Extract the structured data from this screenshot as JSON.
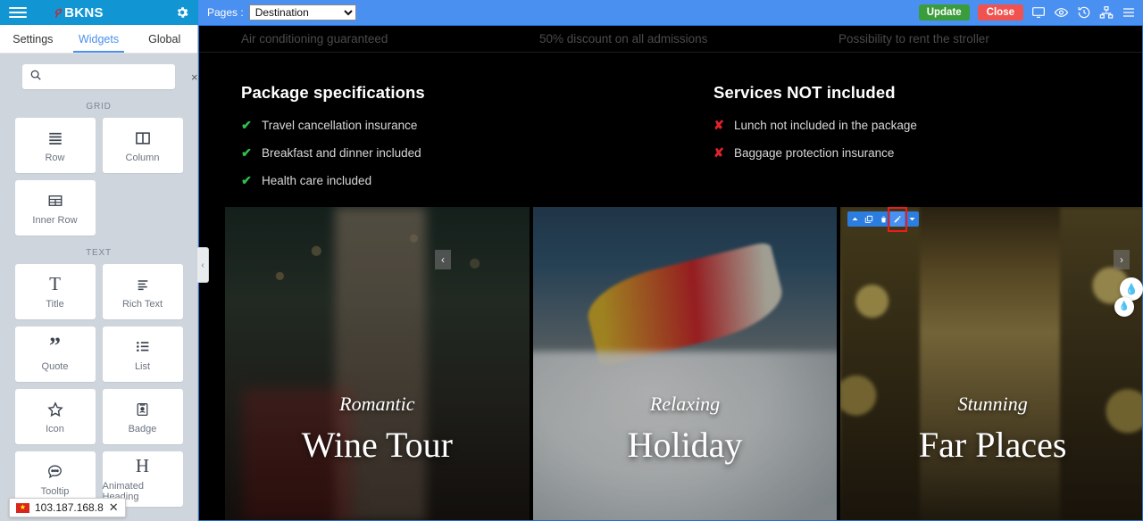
{
  "topbar": {
    "menu_icon": "hamburger-icon",
    "brand_mark": "logo-mark",
    "brand": "BKNS",
    "gear_icon": "gear-icon",
    "pages_label": "Pages :",
    "page_selected": "Destination",
    "page_options": [
      "Destination"
    ],
    "update_label": "Update",
    "close_label": "Close",
    "icons": [
      "desktop-icon",
      "eye-icon",
      "history-icon",
      "sitemap-icon",
      "menu-icon"
    ]
  },
  "panel": {
    "tabs": [
      {
        "label": "Settings",
        "active": false
      },
      {
        "label": "Widgets",
        "active": true
      },
      {
        "label": "Global",
        "active": false
      }
    ],
    "search": {
      "value": "",
      "placeholder": "",
      "icon": "search-icon",
      "clear": "×"
    },
    "groups": [
      {
        "title": "GRID",
        "items": [
          {
            "label": "Row",
            "icon": "rows-icon"
          },
          {
            "label": "Column",
            "icon": "columns-icon"
          },
          {
            "label": "Inner Row",
            "icon": "table-icon"
          }
        ]
      },
      {
        "title": "TEXT",
        "items": [
          {
            "label": "Title",
            "icon": "title-icon"
          },
          {
            "label": "Rich Text",
            "icon": "align-left-icon"
          },
          {
            "label": "Quote",
            "icon": "quote-icon"
          },
          {
            "label": "List",
            "icon": "list-icon"
          },
          {
            "label": "Icon",
            "icon": "star-icon"
          },
          {
            "label": "Badge",
            "icon": "badge-icon"
          },
          {
            "label": "Tooltip",
            "icon": "tooltip-icon"
          },
          {
            "label": "Animated Heading",
            "icon": "heading-icon"
          }
        ]
      }
    ],
    "ip_badge": {
      "flag": "vn-flag-icon",
      "ip": "103.187.168.8",
      "close": "✕"
    }
  },
  "canvas": {
    "top_strip": [
      "Air conditioning guaranteed",
      "50% discount on all admissions",
      "Possibility to rent the stroller"
    ],
    "specs": {
      "included": {
        "heading": "Package specifications",
        "items": [
          "Travel cancellation insurance",
          "Breakfast and dinner included",
          "Health care included"
        ],
        "mark": "✔"
      },
      "excluded": {
        "heading": "Services NOT included",
        "items": [
          "Lunch not included in the package",
          "Baggage protection insurance"
        ],
        "mark": "✘"
      }
    },
    "element_toolbar": {
      "buttons": [
        {
          "name": "move-up-icon",
          "glyph": "▲",
          "selected": false
        },
        {
          "name": "duplicate-icon",
          "glyph": "⧉",
          "selected": false
        },
        {
          "name": "delete-icon",
          "glyph": "Ὕ1",
          "selected": false
        },
        {
          "name": "edit-pencil-icon",
          "glyph": "✎",
          "selected": true
        },
        {
          "name": "more-options-icon",
          "glyph": "▼",
          "selected": false
        }
      ],
      "highlight_color": "#ee1b1b"
    },
    "carousel": {
      "prev": "‹",
      "next": "›",
      "slides": [
        {
          "subtitle": "Romantic",
          "title": "Wine Tour"
        },
        {
          "subtitle": "Relaxing",
          "title": "Holiday"
        },
        {
          "subtitle": "Stunning",
          "title": "Far Places"
        }
      ]
    },
    "collapse_handle": "‹",
    "water_widget": {
      "icon": "water-drop-icon",
      "glyph": "◆"
    }
  },
  "colors": {
    "brand_blue": "#1196d3",
    "topbar_blue": "#4a90f0",
    "update_green": "#3b9c3b",
    "close_red": "#f0534f",
    "panel_gray": "#cfd5dd",
    "check_green": "#2ec24d",
    "cross_red": "#e0232a",
    "highlight_red": "#ee1b1b"
  }
}
